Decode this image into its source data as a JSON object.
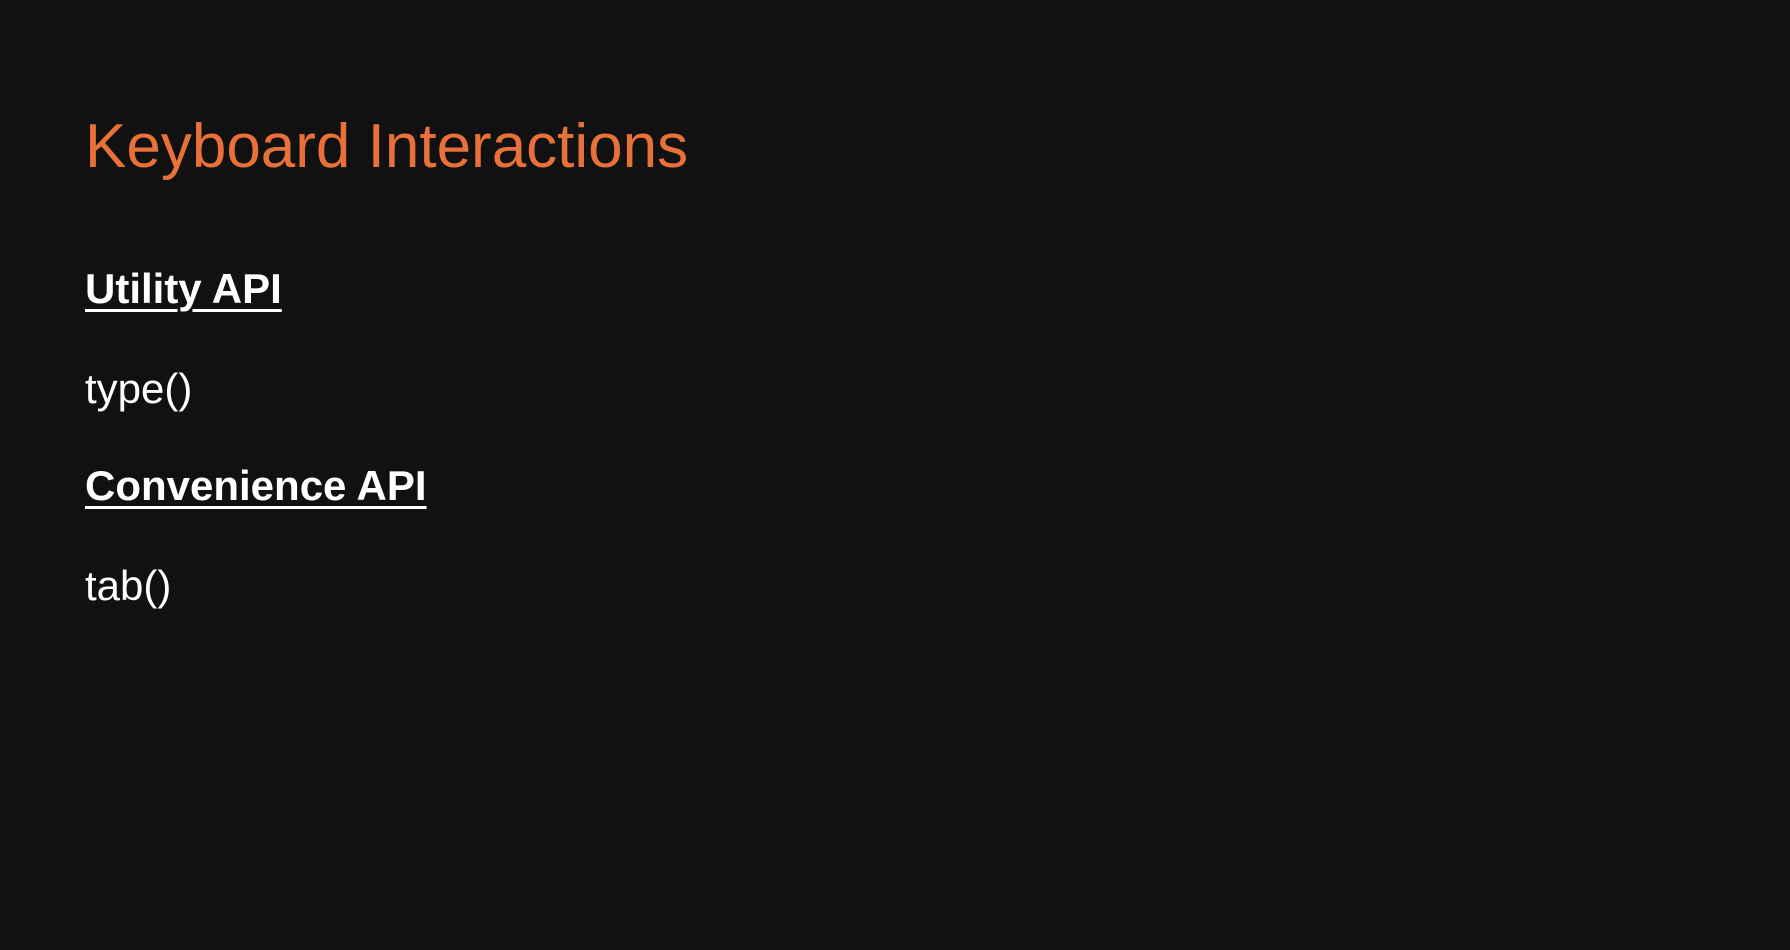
{
  "slide": {
    "title": "Keyboard Interactions",
    "sections": [
      {
        "heading": "Utility API",
        "method": "type()"
      },
      {
        "heading": "Convenience API",
        "method": "tab()"
      }
    ]
  },
  "colors": {
    "background": "#111111",
    "title": "#e8713a",
    "text": "#ffffff"
  }
}
